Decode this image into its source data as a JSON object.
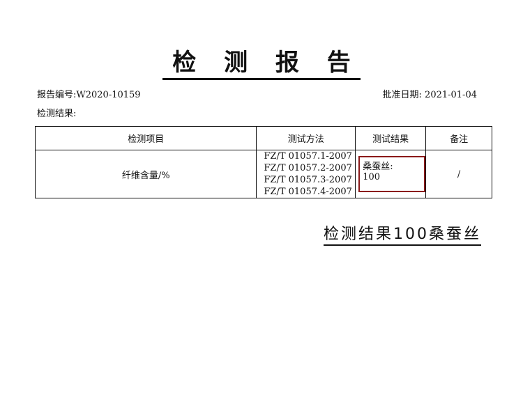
{
  "document": {
    "title": "检 测 报 告",
    "report_number": "报告编号:W2020-10159",
    "approval_date": "批准日期: 2021-01-04",
    "results_label": "检测结果:"
  },
  "table": {
    "headers": [
      "检测项目",
      "测试方法",
      "测试结果",
      "备注"
    ],
    "rows": [
      {
        "item": "纤维含量/%",
        "methods": [
          "FZ/T 01057.1-2007",
          "FZ/T 01057.2-2007",
          "FZ/T 01057.3-2007",
          "FZ/T 01057.4-2007"
        ],
        "result": "桑蚕丝: 100",
        "remark": "/"
      }
    ]
  },
  "annotation": {
    "text": "检测结果100桑蚕丝",
    "highlight_color": "#8b1a1a"
  }
}
